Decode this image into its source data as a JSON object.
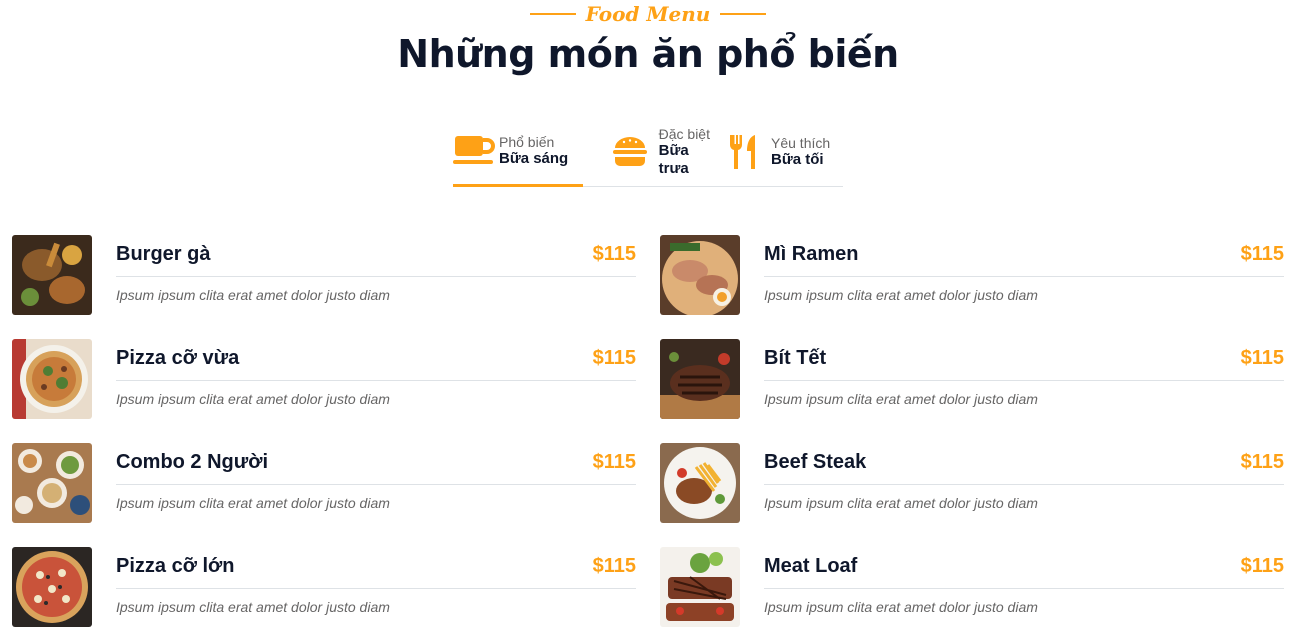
{
  "header": {
    "eyebrow": "Food Menu",
    "title": "Những món ăn phổ biến"
  },
  "tabs": [
    {
      "small": "Phổ biến",
      "big": "Bữa sáng",
      "icon": "coffee-icon",
      "active": true
    },
    {
      "small": "Đặc biệt",
      "big": "Bữa trưa",
      "icon": "hamburger-icon",
      "active": false
    },
    {
      "small": "Yêu thích",
      "big": "Bữa tối",
      "icon": "utensils-icon",
      "active": false
    }
  ],
  "menu": {
    "left": [
      {
        "name": "Burger gà",
        "price": "$115",
        "desc": "Ipsum ipsum clita erat amet dolor justo diam"
      },
      {
        "name": "Pizza cỡ vừa",
        "price": "$115",
        "desc": "Ipsum ipsum clita erat amet dolor justo diam"
      },
      {
        "name": "Combo 2 Người",
        "price": "$115",
        "desc": "Ipsum ipsum clita erat amet dolor justo diam"
      },
      {
        "name": "Pizza cỡ lớn",
        "price": "$115",
        "desc": "Ipsum ipsum clita erat amet dolor justo diam"
      }
    ],
    "right": [
      {
        "name": "Mì Ramen",
        "price": "$115",
        "desc": "Ipsum ipsum clita erat amet dolor justo diam"
      },
      {
        "name": "Bít Tết",
        "price": "$115",
        "desc": "Ipsum ipsum clita erat amet dolor justo diam"
      },
      {
        "name": "Beef Steak",
        "price": "$115",
        "desc": "Ipsum ipsum clita erat amet dolor justo diam"
      },
      {
        "name": "Meat Loaf",
        "price": "$115",
        "desc": "Ipsum ipsum clita erat amet dolor justo diam"
      }
    ]
  },
  "colors": {
    "accent": "#FEA116",
    "dark": "#0F172B",
    "muted": "#666565"
  }
}
